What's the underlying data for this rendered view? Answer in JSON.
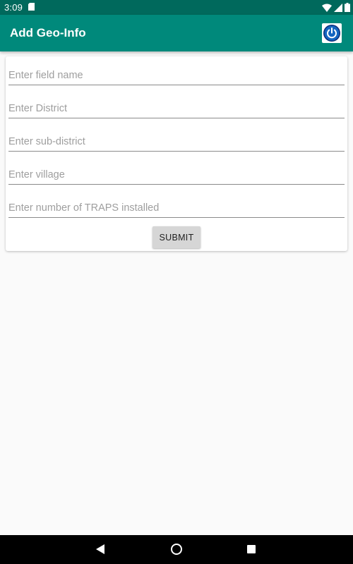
{
  "status_bar": {
    "time": "3:09",
    "icons": [
      "sd-card-icon",
      "wifi-icon",
      "signal-icon",
      "battery-icon"
    ]
  },
  "app_bar": {
    "title": "Add Geo-Info",
    "action_icon": "power-icon",
    "color": "#00897b",
    "status_color": "#00695c"
  },
  "form": {
    "fields": [
      {
        "name": "field-name-input",
        "placeholder": "Enter field name",
        "value": ""
      },
      {
        "name": "district-input",
        "placeholder": "Enter District",
        "value": ""
      },
      {
        "name": "sub-district-input",
        "placeholder": "Enter sub-district",
        "value": ""
      },
      {
        "name": "village-input",
        "placeholder": "Enter village",
        "value": ""
      },
      {
        "name": "traps-count-input",
        "placeholder": "Enter number of TRAPS installed",
        "value": ""
      }
    ],
    "submit_label": "SUBMIT"
  },
  "nav_bar": {
    "icons": [
      "back-icon",
      "home-icon",
      "recents-icon"
    ]
  }
}
